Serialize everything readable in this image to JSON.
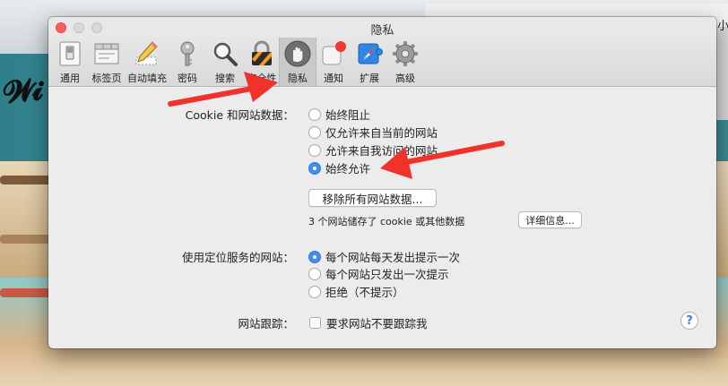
{
  "window": {
    "title": "隐私"
  },
  "background": {
    "partial_label": "小"
  },
  "toolbar": {
    "items": [
      {
        "label": "通用",
        "icon": "general-switch-icon"
      },
      {
        "label": "标签页",
        "icon": "tabs-icon"
      },
      {
        "label": "自动填充",
        "icon": "autofill-pencil-icon"
      },
      {
        "label": "密码",
        "icon": "key-icon"
      },
      {
        "label": "搜索",
        "icon": "magnifier-icon"
      },
      {
        "label": "安全性",
        "icon": "padlock-icon"
      },
      {
        "label": "隐私",
        "icon": "hand-icon",
        "selected": true
      },
      {
        "label": "通知",
        "icon": "notification-badge-icon"
      },
      {
        "label": "扩展",
        "icon": "puzzle-compass-icon"
      },
      {
        "label": "高级",
        "icon": "gear-icon"
      }
    ]
  },
  "cookies": {
    "label": "Cookie 和网站数据：",
    "options": [
      {
        "label": "始终阻止",
        "checked": false
      },
      {
        "label": "仅允许来自当前的网站",
        "checked": false
      },
      {
        "label": "允许来自我访问的网站",
        "checked": false
      },
      {
        "label": "始终允许",
        "checked": true
      }
    ],
    "remove_button": "移除所有网站数据...",
    "stored_info": "3 个网站储存了 cookie 或其他数据",
    "details_button": "详细信息..."
  },
  "location": {
    "label": "使用定位服务的网站：",
    "options": [
      {
        "label": "每个网站每天发出提示一次",
        "checked": true
      },
      {
        "label": "每个网站只发出一次提示",
        "checked": false
      },
      {
        "label": "拒绝（不提示）",
        "checked": false
      }
    ]
  },
  "tracking": {
    "label": "网站跟踪：",
    "checkbox_label": "要求网站不要跟踪我",
    "checked": false
  },
  "help_button": "?",
  "colors": {
    "accent": "#3f8ef6",
    "annotation_arrow": "#f0322b"
  }
}
